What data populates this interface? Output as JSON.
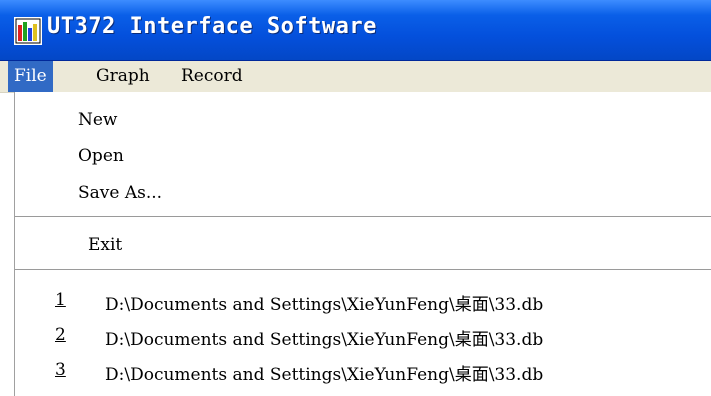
{
  "window": {
    "title": "UT372 Interface Software"
  },
  "menubar": {
    "items": [
      {
        "label": "File",
        "active": true
      },
      {
        "label": "Graph",
        "active": false
      },
      {
        "label": "Record",
        "active": false
      }
    ]
  },
  "file_menu": {
    "new_label": "New",
    "open_label": "Open",
    "save_as_label": "Save As...",
    "exit_label": "Exit",
    "recent_files": [
      {
        "number": "1",
        "path": "D:\\Documents and Settings\\XieYunFeng\\桌面\\33.db"
      },
      {
        "number": "2",
        "path": "D:\\Documents and Settings\\XieYunFeng\\桌面\\33.db"
      },
      {
        "number": "3",
        "path": "D:\\Documents and Settings\\XieYunFeng\\桌面\\33.db"
      }
    ]
  },
  "colors": {
    "titlebar": "#0450dc",
    "menu_highlight": "#316ac5",
    "menubar_bg": "#ece9d8"
  }
}
